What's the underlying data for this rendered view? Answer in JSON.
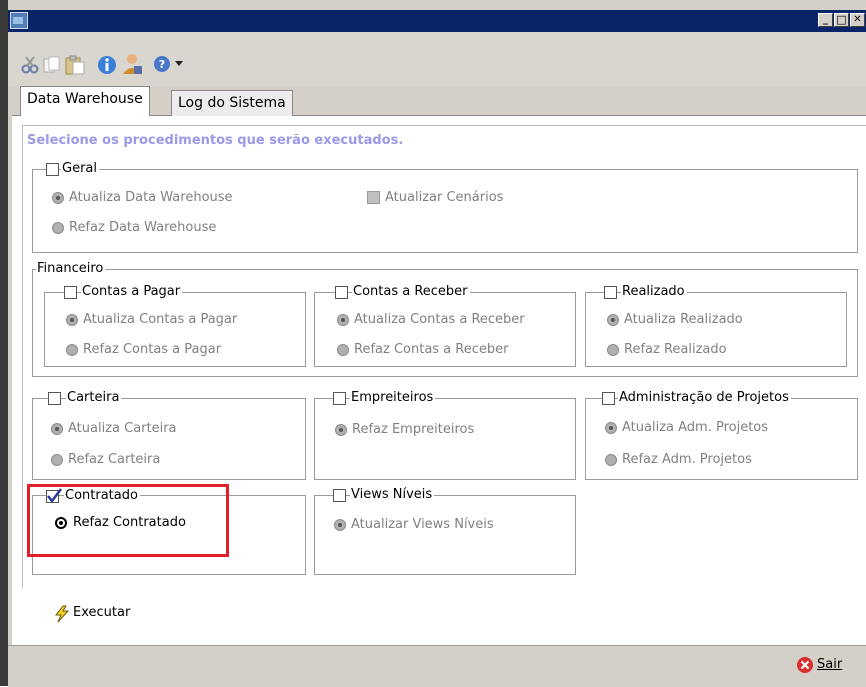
{
  "window": {
    "min_label": "_",
    "max_label": "□",
    "close_label": "✕"
  },
  "toolbar": {
    "icons": [
      "cut-icon",
      "copy-icon",
      "paste-icon",
      "info-icon",
      "user-icon",
      "help-icon",
      "dropdown-arrow-icon"
    ]
  },
  "tabs": [
    {
      "label": "Data Warehouse"
    },
    {
      "label": "Log do Sistema"
    }
  ],
  "instruction": "Selecione os procedimentos que serão executados.",
  "geral": {
    "title": "Geral",
    "opt1": "Atualiza Data Warehouse",
    "opt2": "Refaz Data Warehouse",
    "cenarios": "Atualizar Cenários"
  },
  "financeiro": {
    "title": "Financeiro",
    "pagar": {
      "title": "Contas a Pagar",
      "opt1": "Atualiza Contas a Pagar",
      "opt2": "Refaz Contas a Pagar"
    },
    "receber": {
      "title": "Contas a Receber",
      "opt1": "Atualiza Contas a Receber",
      "opt2": "Refaz Contas a Receber"
    },
    "realizado": {
      "title": "Realizado",
      "opt1": "Atualiza Realizado",
      "opt2": "Refaz Realizado"
    }
  },
  "carteira": {
    "title": "Carteira",
    "opt1": "Atualiza Carteira",
    "opt2": "Refaz Carteira"
  },
  "empreiteiros": {
    "title": "Empreiteiros",
    "opt1": "Refaz Empreiteiros"
  },
  "adm": {
    "title": "Administração de Projetos",
    "opt1": "Atualiza Adm. Projetos",
    "opt2": "Refaz Adm. Projetos"
  },
  "contratado": {
    "title": "Contratado",
    "opt1": "Refaz Contratado",
    "checked": true
  },
  "views": {
    "title": "Views Níveis",
    "opt1": "Atualizar Views Níveis"
  },
  "actions": {
    "executar": "Executar",
    "sair": "Sair"
  },
  "colors": {
    "titlebar": "#0a246a",
    "highlight": "#e0202a",
    "instruction": "#9a9ae8"
  }
}
